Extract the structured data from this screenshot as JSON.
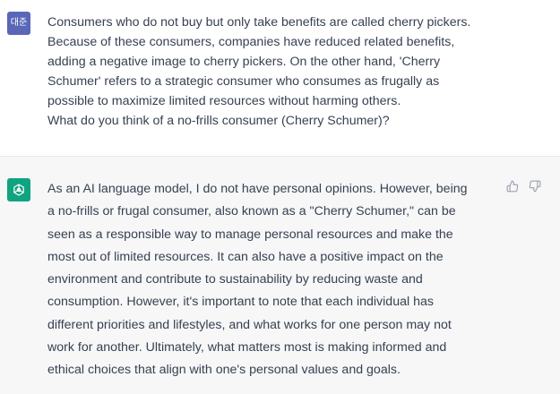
{
  "user": {
    "avatar_text": "대준",
    "lines": [
      "Consumers who do not buy but only take benefits are called cherry pickers.",
      "Because of these consumers, companies have reduced related benefits,",
      "adding a negative image to cherry pickers. On the other hand, 'Cherry",
      "Schumer' refers to a strategic consumer who consumes as frugally as",
      "possible to maximize limited resources without harming others.",
      "What do you think of a no-frills consumer (Cherry Schumer)?"
    ]
  },
  "assistant": {
    "avatar_icon": "openai-logo-icon",
    "lines": [
      "As an AI language model, I do not have personal opinions. However, being",
      "a no-frills or frugal consumer, also known as a \"Cherry Schumer,\" can be",
      "seen as a responsible way to manage personal resources and make the",
      "most out of limited resources. It can also have a positive impact on the",
      "environment and contribute to sustainability by reducing waste and",
      "consumption. However, it's important to note that each individual has",
      "different priorities and lifestyles, and what works for one person may not",
      "work for another. Ultimately, what matters most is making informed and",
      "ethical choices that align with one's personal values and goals."
    ],
    "feedback_icons": [
      "thumbs-up-icon",
      "thumbs-down-icon"
    ]
  },
  "colors": {
    "user_avatar_bg": "#5a67b8",
    "bot_avatar_bg": "#10a37f",
    "assistant_bg": "#f7f7f8",
    "text": "#374151"
  }
}
